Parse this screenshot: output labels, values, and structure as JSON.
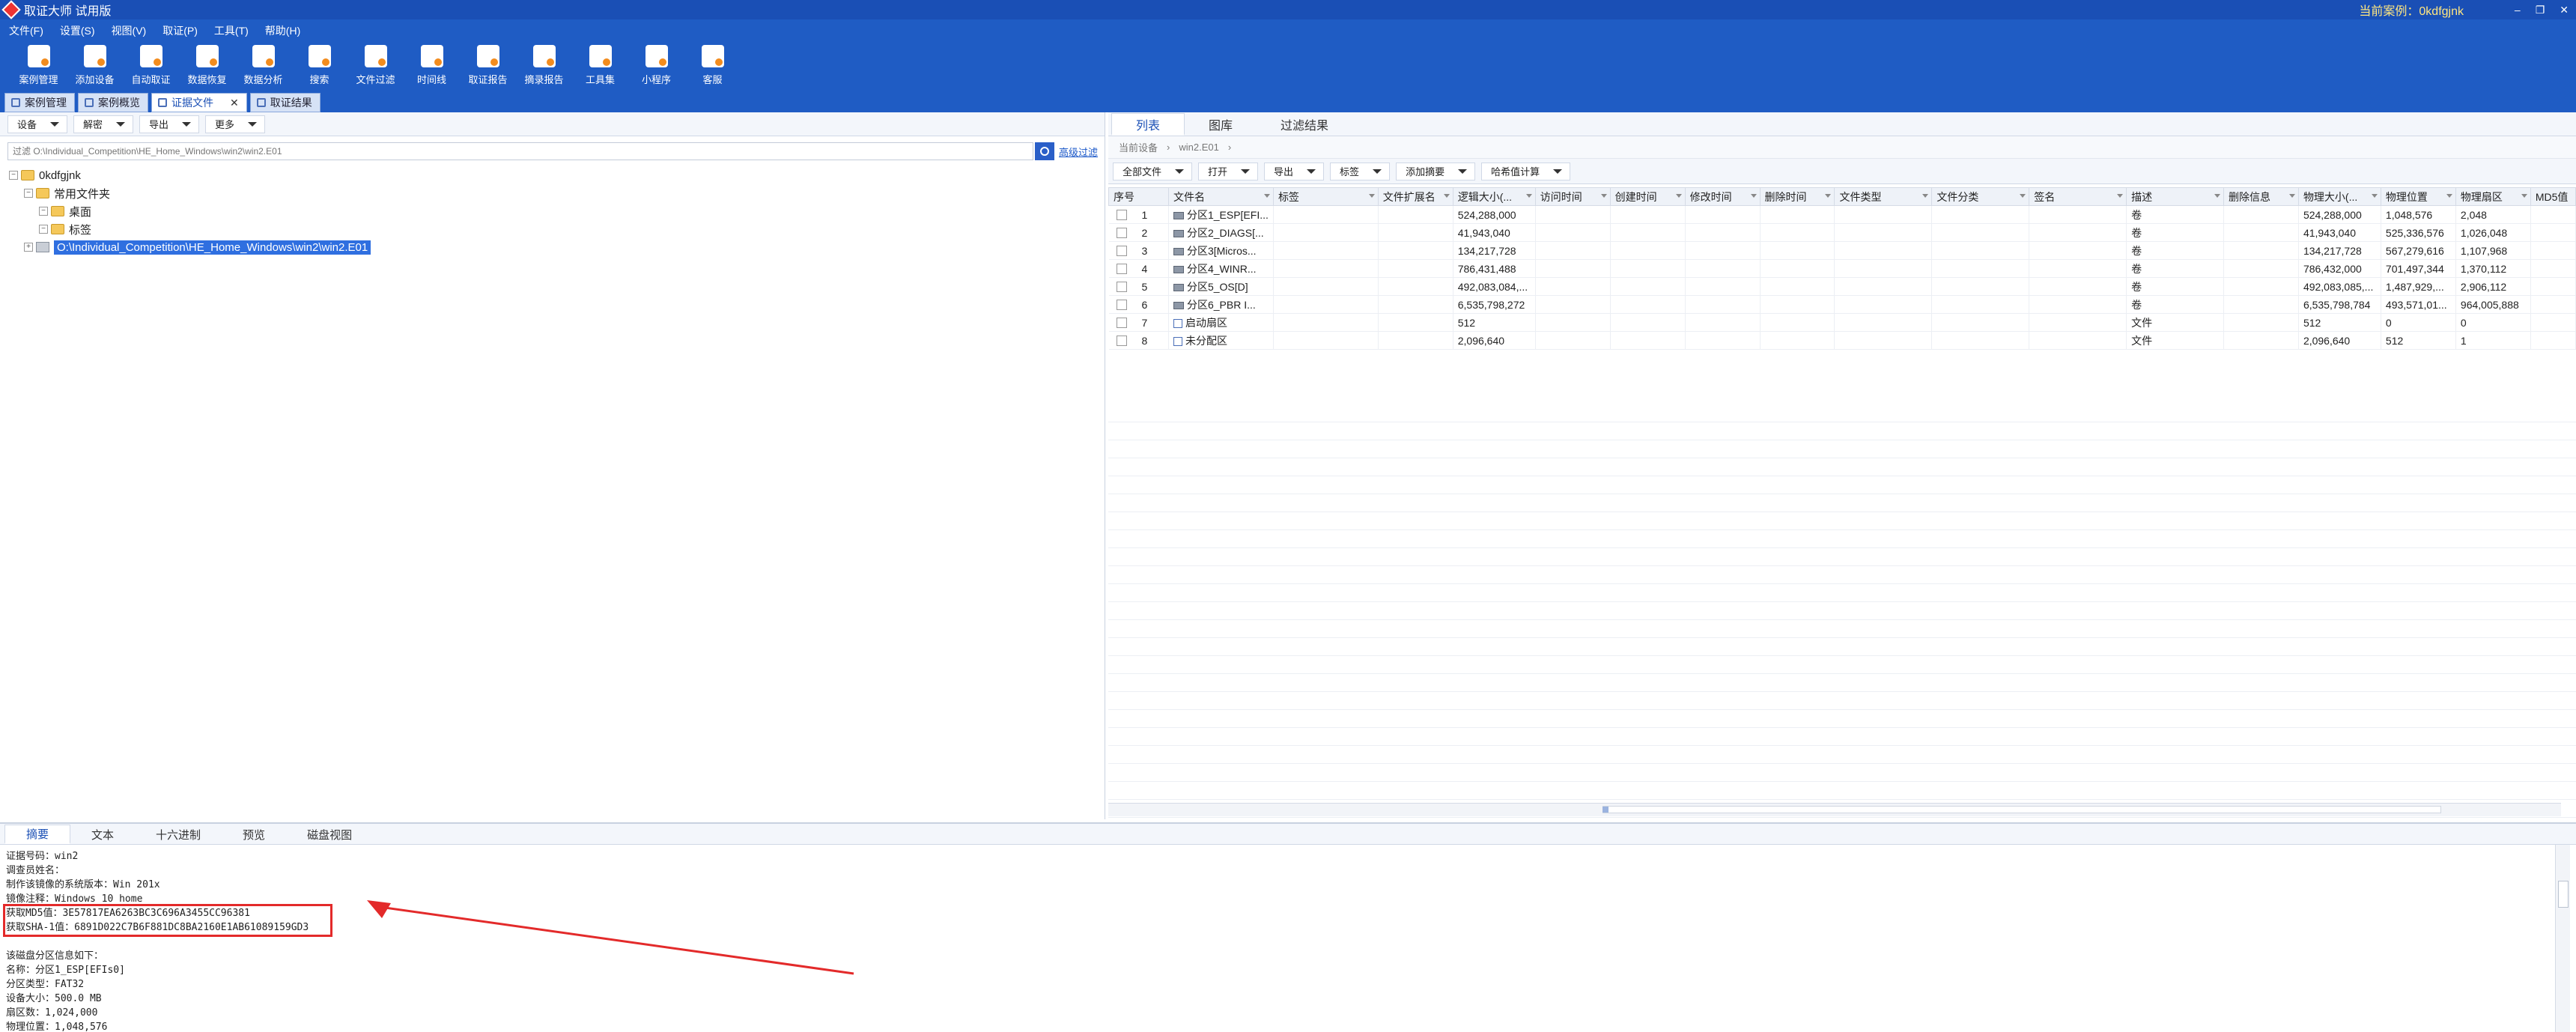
{
  "app": {
    "title": "取证大师 试用版",
    "current_case": "当前案例：0kdfgjnk",
    "window_buttons": [
      "–",
      "❐",
      "✕"
    ]
  },
  "menu": [
    "文件(F)",
    "设置(S)",
    "视图(V)",
    "取证(P)",
    "工具(T)",
    "帮助(H)"
  ],
  "toolbar": [
    {
      "label": "案例管理",
      "icon": "case-management-icon"
    },
    {
      "label": "添加设备",
      "icon": "add-device-icon"
    },
    {
      "label": "自动取证",
      "icon": "auto-forensics-icon"
    },
    {
      "label": "数据恢复",
      "icon": "data-recovery-icon"
    },
    {
      "label": "数据分析",
      "icon": "data-analysis-icon"
    },
    {
      "label": "搜索",
      "icon": "search-icon"
    },
    {
      "label": "文件过滤",
      "icon": "file-filter-icon"
    },
    {
      "label": "时间线",
      "icon": "timeline-icon"
    },
    {
      "label": "取证报告",
      "icon": "report-icon"
    },
    {
      "label": "摘录报告",
      "icon": "excerpt-report-icon"
    },
    {
      "label": "工具集",
      "icon": "toolkit-icon"
    },
    {
      "label": "小程序",
      "icon": "mini-program-icon"
    },
    {
      "label": "客服",
      "icon": "support-icon"
    }
  ],
  "doc_tabs": [
    {
      "label": "案例管理",
      "active": false
    },
    {
      "label": "案例概览",
      "active": false
    },
    {
      "label": "证据文件",
      "active": true,
      "close": "✕"
    },
    {
      "label": "取证结果",
      "active": false
    }
  ],
  "left": {
    "toolbar": [
      "设备",
      "解密",
      "导出",
      "更多"
    ],
    "filter_placeholder": "过滤 O:\\Individual_Competition\\HE_Home_Windows\\win2\\win2.E01",
    "advanced_filter": "高级过滤",
    "tree": {
      "root": "0kdfgjnk",
      "common": "常用文件夹",
      "desktop": "桌面",
      "tags": "标签",
      "evidence": "O:\\Individual_Competition\\HE_Home_Windows\\win2\\win2.E01"
    }
  },
  "right": {
    "tabs": [
      "列表",
      "图库",
      "过滤结果"
    ],
    "breadcrumb": [
      "当前设备",
      "win2.E01"
    ],
    "toolbar": [
      "全部文件",
      "打开",
      "导出",
      "标签",
      "添加摘要",
      "哈希值计算"
    ],
    "columns": [
      "序号",
      "文件名",
      "标签",
      "文件扩展名",
      "逻辑大小(...",
      "访问时间",
      "创建时间",
      "修改时间",
      "删除时间",
      "文件类型",
      "文件分类",
      "签名",
      "描述",
      "删除信息",
      "物理大小(...",
      "物理位置",
      "物理扇区",
      "MD5值"
    ],
    "rows": [
      {
        "no": "1",
        "name": "分区1_ESP[EFI...",
        "icon": "volume",
        "logical": "524,288,000",
        "desc": "卷",
        "phys_size": "524,288,000",
        "phys_pos": "1,048,576",
        "phys_sector": "2,048"
      },
      {
        "no": "2",
        "name": "分区2_DIAGS[...",
        "icon": "volume",
        "logical": "41,943,040",
        "desc": "卷",
        "phys_size": "41,943,040",
        "phys_pos": "525,336,576",
        "phys_sector": "1,026,048"
      },
      {
        "no": "3",
        "name": "分区3[Micros...",
        "icon": "volume",
        "logical": "134,217,728",
        "desc": "卷",
        "phys_size": "134,217,728",
        "phys_pos": "567,279,616",
        "phys_sector": "1,107,968"
      },
      {
        "no": "4",
        "name": "分区4_WINR...",
        "icon": "volume",
        "logical": "786,431,488",
        "desc": "卷",
        "phys_size": "786,432,000",
        "phys_pos": "701,497,344",
        "phys_sector": "1,370,112"
      },
      {
        "no": "5",
        "name": "分区5_OS[D]",
        "icon": "volume",
        "logical": "492,083,084,...",
        "desc": "卷",
        "phys_size": "492,083,085,...",
        "phys_pos": "1,487,929,...",
        "phys_sector": "2,906,112"
      },
      {
        "no": "6",
        "name": "分区6_PBR I...",
        "icon": "volume",
        "logical": "6,535,798,272",
        "desc": "卷",
        "phys_size": "6,535,798,784",
        "phys_pos": "493,571,01...",
        "phys_sector": "964,005,888"
      },
      {
        "no": "7",
        "name": "启动扇区",
        "icon": "sector",
        "logical": "512",
        "desc": "文件",
        "phys_size": "512",
        "phys_pos": "0",
        "phys_sector": "0"
      },
      {
        "no": "8",
        "name": "未分配区",
        "icon": "sector",
        "logical": "2,096,640",
        "desc": "文件",
        "phys_size": "2,096,640",
        "phys_pos": "512",
        "phys_sector": "1"
      }
    ]
  },
  "bottom": {
    "tabs": [
      "摘要",
      "文本",
      "十六进制",
      "预览",
      "磁盘视图"
    ],
    "summary_lines": [
      "证据号码：win2",
      "调查员姓名：",
      "制作该镜像的系统版本：Win 201x",
      "镜像注释：Windows 10 home",
      "获取MD5值：3E57817EA6263BC3C696A3455CC96381",
      "获取SHA-1值：6891D022C7B6F881DC8BA2160E1AB61089159GD3"
    ],
    "summary_lines2": [
      "该磁盘分区信息如下：",
      "名称：分区1_ESP[EFIs0]",
      "分区类型：FAT32",
      "设备大小：500.0 MB",
      "扇区数：1,024,000",
      "物理位置：1,048,576"
    ]
  },
  "colors": {
    "title_bar": "#1a4fb5",
    "ribbon": "#1f5cc4",
    "highlight": "#e32a2a",
    "selection": "#2f6fe0"
  }
}
